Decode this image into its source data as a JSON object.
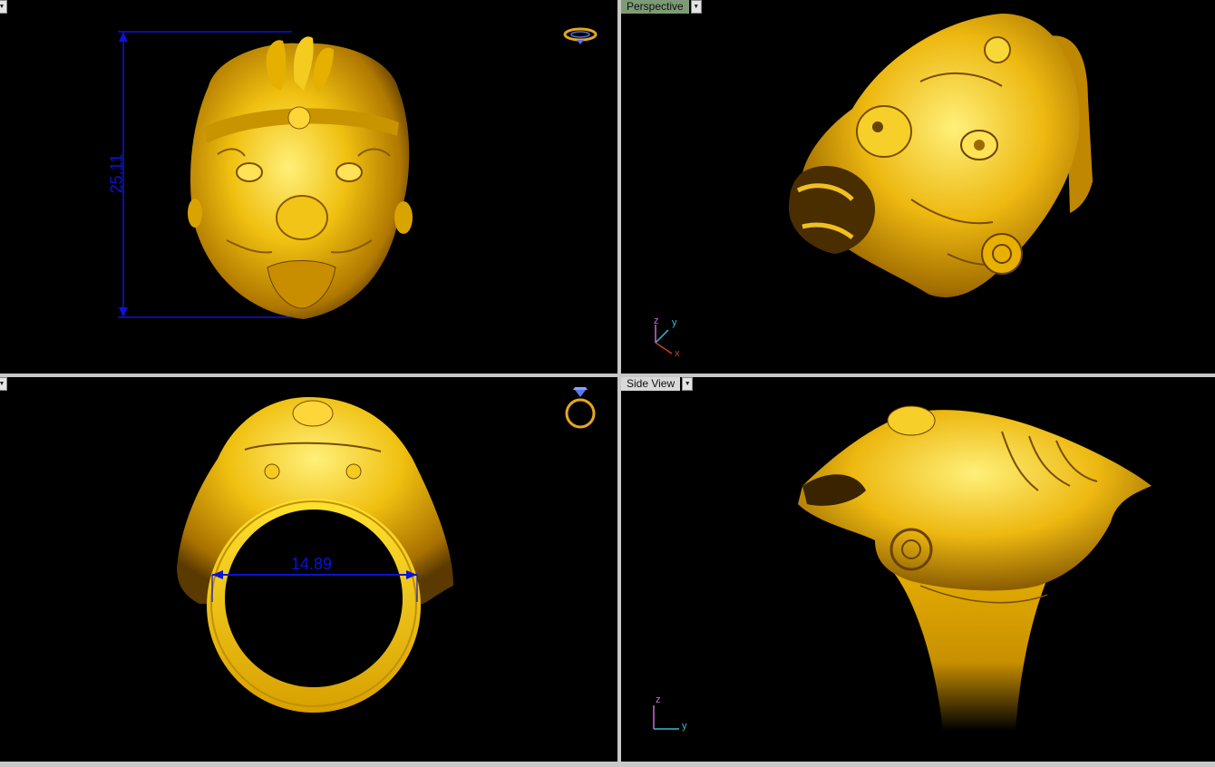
{
  "viewports": {
    "top_left": {
      "dimension_label": "25.11",
      "dimension_line_color": "#0a14d6"
    },
    "top_right": {
      "tab_label": "Perspective",
      "axes": {
        "z": "z",
        "y": "y",
        "x": "x"
      }
    },
    "bottom_left": {
      "dimension_label": "14.89",
      "dimension_line_color": "#0a14d6"
    },
    "bottom_right": {
      "tab_label": "Side View",
      "axes": {
        "z": "z",
        "y": "y"
      }
    }
  },
  "colors": {
    "viewport_bg": "#000000",
    "separator": "#c8c8c8",
    "gold_light": "#ffe455",
    "gold_mid": "#e8b200",
    "gold_dark": "#8a5a00",
    "active_tab": "#7d9b77"
  },
  "icons": {
    "view_gadget_top": "ring-top-view-icon",
    "view_gadget_front": "ring-front-view-icon",
    "dropdown": "chevron-down-icon"
  }
}
